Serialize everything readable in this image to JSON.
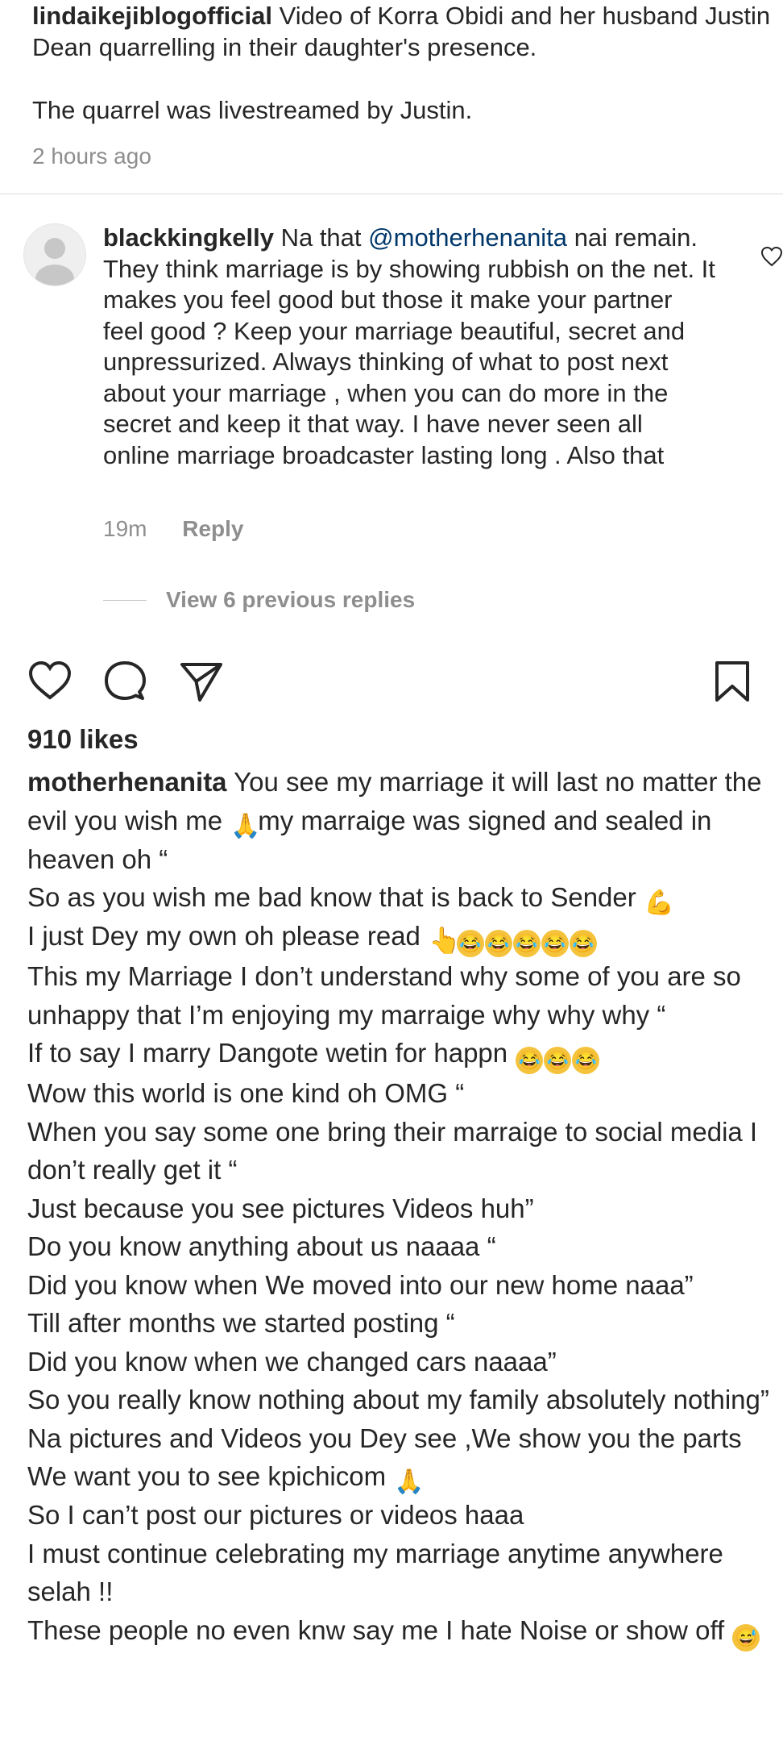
{
  "post_caption_top": {
    "username": "lindaikejiblogofficial",
    "text": "Video of Korra Obidi and her husband Justin Dean quarrelling in their daughter's presence.",
    "text2": "The quarrel was livestreamed by Justin.",
    "time": "2 hours ago"
  },
  "comment": {
    "username": "blackkingkelly",
    "prefix": "Na that",
    "mention": "@motherhenanita",
    "body": "nai remain. They think marriage is by showing rubbish on the net. It makes you feel good but those it make your partner feel good ? Keep your marriage beautiful, secret and unpressurized. Always thinking of what to post next about your marriage , when you can do more in the secret and keep it that way. I have never seen all online marriage broadcaster lasting long . Also that",
    "time": "19m",
    "reply_label": "Reply",
    "view_replies": "View 6 previous replies"
  },
  "actions": {
    "like": "heart-icon",
    "comment": "comment-icon",
    "share": "send-icon",
    "save": "bookmark-icon"
  },
  "likes": "910 likes",
  "caption": {
    "username": "motherhenanita",
    "lines": [
      "You see my marriage it will last no matter the evil you wish me",
      "my marraige was signed and sealed in heaven oh “",
      "So as you wish me bad know that is back to Sender",
      "I just Dey my own oh please read",
      "This my Marriage I don’t understand why some of you are so unhappy that I’m enjoying my marraige why why why “",
      "If to say I marry Dangote wetin for happn",
      "Wow this world is one kind oh OMG “",
      "When you say some one bring their marraige to social media I don’t really get it “",
      "Just because you see pictures Videos huh”",
      "Do you know anything about us naaaa “",
      "Did you know when We moved into our new home naaa”",
      "Till after months we started posting “",
      "Did you know when we changed cars naaaa”",
      "So you really know nothing about my family absolutely nothing”",
      "Na pictures and Videos you Dey see ,We show you the parts We want you to see kpichicom",
      "So I can’t post our pictures or videos haaa",
      "I must continue celebrating my marriage anytime anywhere selah !!",
      "These people no even knw say me I hate Noise or show off"
    ]
  }
}
